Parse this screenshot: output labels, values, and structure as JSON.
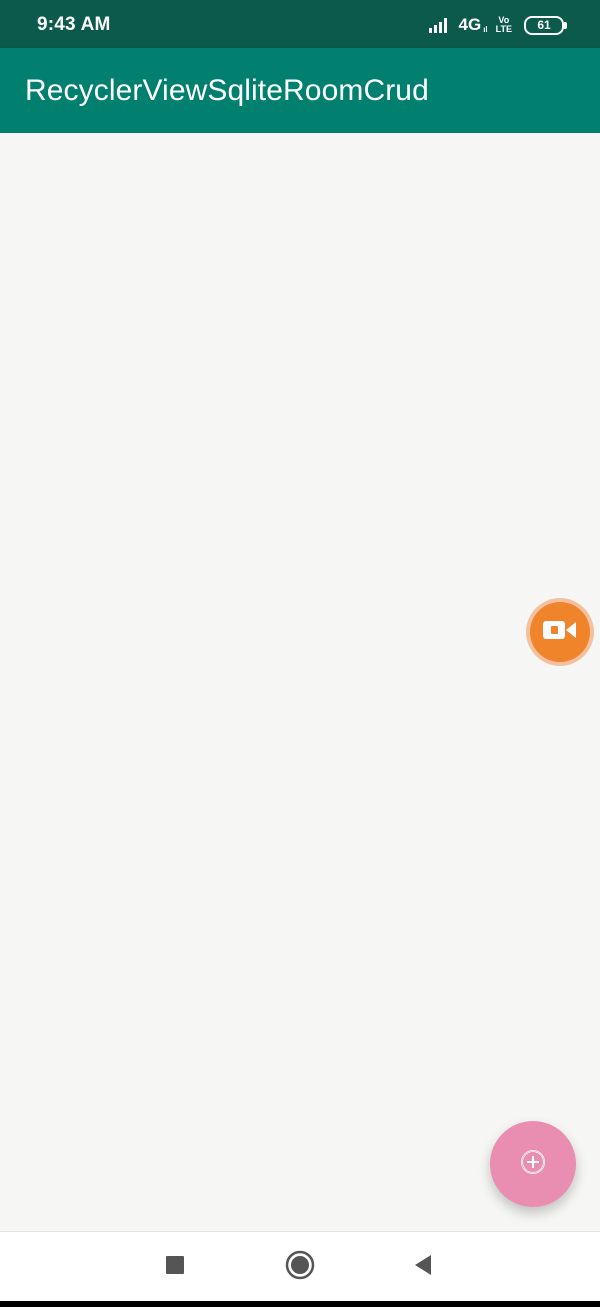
{
  "status_bar": {
    "time": "9:43 AM",
    "network": "4G",
    "network_sub": "ıl",
    "volte_top": "Vo",
    "volte_bottom": "LTE",
    "battery": "61",
    "icons": [
      "signal-icon",
      "battery-icon"
    ]
  },
  "app_bar": {
    "title": "RecyclerViewSqliteRoomCrud"
  },
  "floating_recorder": {
    "icon": "video-camera-icon"
  },
  "fab": {
    "icon": "add-circle-icon"
  },
  "nav_bar": {
    "icons": [
      "recents-square-icon",
      "home-circle-icon",
      "back-triangle-icon"
    ]
  },
  "colors": {
    "status_bar": "#0b5a4b",
    "app_bar": "#02806f",
    "background": "#f6f6f5",
    "fab": "#e98db1",
    "recorder": "#f0842a"
  }
}
